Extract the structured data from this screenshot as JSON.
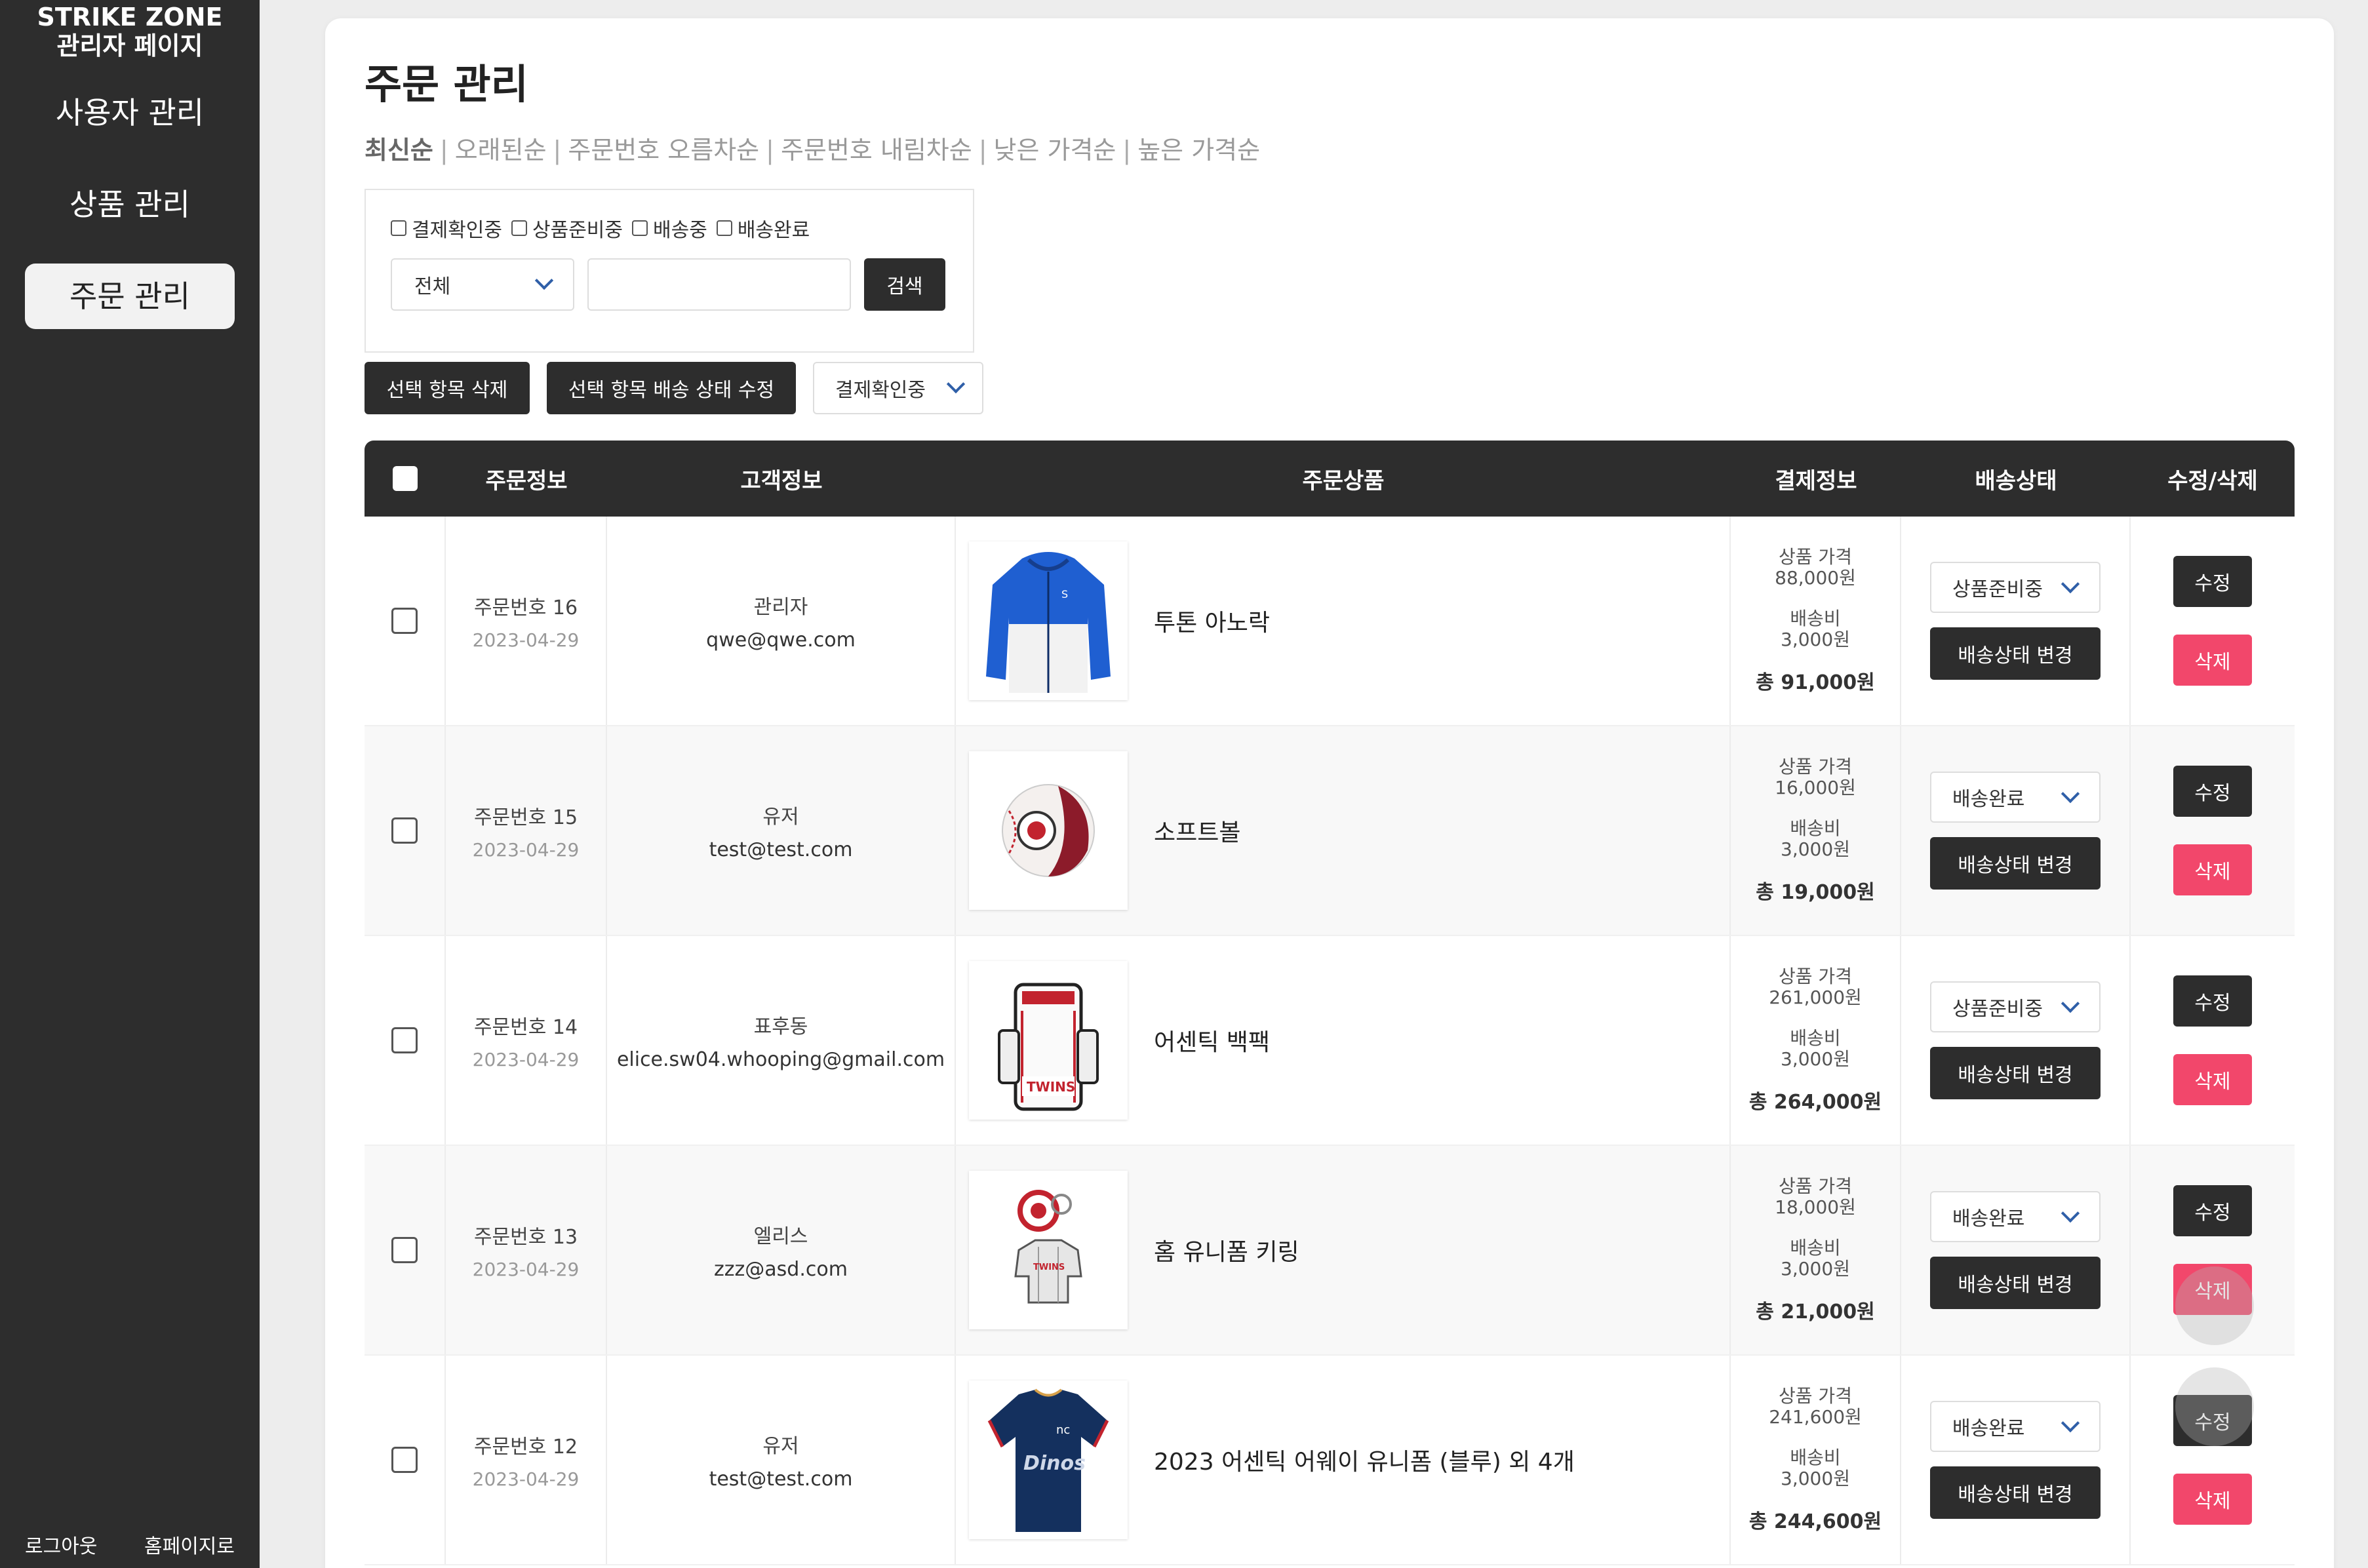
{
  "sidebar": {
    "brand_line1": "STRIKE ZONE",
    "brand_line2": "관리자 페이지",
    "nav": [
      {
        "label": "사용자 관리"
      },
      {
        "label": "상품 관리"
      },
      {
        "label": "주문 관리"
      }
    ],
    "logout": "로그아웃",
    "home": "홈페이지로"
  },
  "main": {
    "title": "주문 관리",
    "sort_options": [
      "최신순",
      "오래된순",
      "주문번호 오름차순",
      "주문번호 내림차순",
      "낮은 가격순",
      "높은 가격순"
    ],
    "filters": {
      "status_checks": [
        "결제확인중",
        "상품준비중",
        "배송중",
        "배송완료"
      ],
      "category_selected": "전체",
      "search_value": "",
      "search_button": "검색"
    },
    "bulk": {
      "delete_label": "선택 항목 삭제",
      "status_label": "선택 항목 배송 상태 수정",
      "status_selected": "결제확인중"
    },
    "table": {
      "headers": [
        "주문정보",
        "고객정보",
        "주문상품",
        "결제정보",
        "배송상태",
        "수정/삭제"
      ],
      "rows": [
        {
          "order_no": "주문번호 16",
          "date": "2023-04-29",
          "name": "관리자",
          "email": "qwe@qwe.com",
          "product": "투톤 아노락",
          "price_label": "상품 가격",
          "price": "88,000원",
          "ship_label": "배송비",
          "ship_fee": "3,000원",
          "total": "총 91,000원",
          "status": "상품준비중",
          "status_button": "배송상태 변경",
          "edit": "수정",
          "delete": "삭제",
          "image": "jacket"
        },
        {
          "order_no": "주문번호 15",
          "date": "2023-04-29",
          "name": "유저",
          "email": "test@test.com",
          "product": "소프트볼",
          "price_label": "상품 가격",
          "price": "16,000원",
          "ship_label": "배송비",
          "ship_fee": "3,000원",
          "total": "총 19,000원",
          "status": "배송완료",
          "status_button": "배송상태 변경",
          "edit": "수정",
          "delete": "삭제",
          "image": "ball"
        },
        {
          "order_no": "주문번호 14",
          "date": "2023-04-29",
          "name": "표후동",
          "email": "elice.sw04.whooping@gmail.com",
          "product": "어센틱 백팩",
          "price_label": "상품 가격",
          "price": "261,000원",
          "ship_label": "배송비",
          "ship_fee": "3,000원",
          "total": "총 264,000원",
          "status": "상품준비중",
          "status_button": "배송상태 변경",
          "edit": "수정",
          "delete": "삭제",
          "image": "backpack"
        },
        {
          "order_no": "주문번호 13",
          "date": "2023-04-29",
          "name": "엘리스",
          "email": "zzz@asd.com",
          "product": "홈 유니폼 키링",
          "price_label": "상품 가격",
          "price": "18,000원",
          "ship_label": "배송비",
          "ship_fee": "3,000원",
          "total": "총 21,000원",
          "status": "배송완료",
          "status_button": "배송상태 변경",
          "edit": "수정",
          "delete": "삭제",
          "image": "keyring"
        },
        {
          "order_no": "주문번호 12",
          "date": "2023-04-29",
          "name": "유저",
          "email": "test@test.com",
          "product": "2023 어센틱 어웨이 유니폼 (블루) 외 4개",
          "price_label": "상품 가격",
          "price": "241,600원",
          "ship_label": "배송비",
          "ship_fee": "3,000원",
          "total": "총 244,600원",
          "status": "배송완료",
          "status_button": "배송상태 변경",
          "edit": "수정",
          "delete": "삭제",
          "image": "jersey"
        }
      ]
    }
  }
}
